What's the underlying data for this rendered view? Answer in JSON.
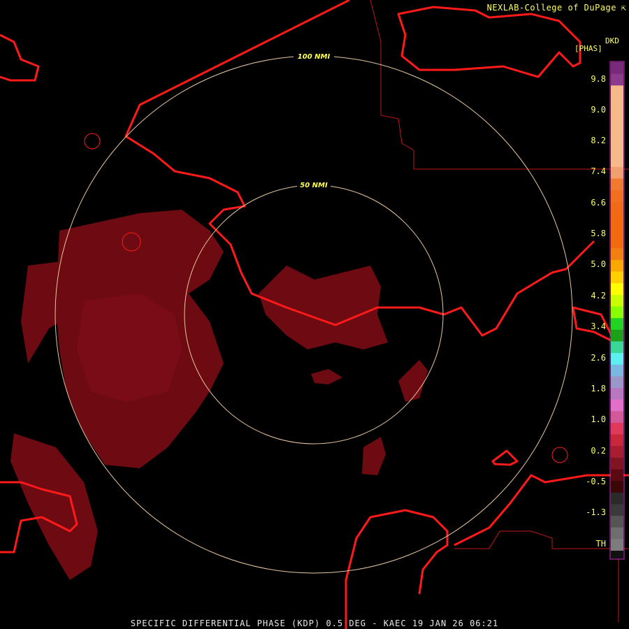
{
  "header": {
    "credit": "NEXLAB-College of DuPage",
    "credit_icon": "cursor-arrow-icon"
  },
  "legend": {
    "product_code": "DKD",
    "units": "[PHAS]",
    "ticks": [
      "9.8",
      "9.0",
      "8.2",
      "7.4",
      "6.6",
      "5.8",
      "5.0",
      "4.2",
      "3.4",
      "2.6",
      "1.8",
      "1.0",
      "0.2",
      "-0.5",
      "-1.3",
      "TH"
    ],
    "colors": [
      "#7a2a7a",
      "#8c3a8c",
      "#f6b98a",
      "#f6b98a",
      "#f6b98a",
      "#f6b98a",
      "#f6b98a",
      "#f6b98a",
      "#f6b98a",
      "#f0a070",
      "#f07a30",
      "#f07020",
      "#f06a18",
      "#f26a10",
      "#f26a10",
      "#f26a10",
      "#f28010",
      "#f8a800",
      "#ffd000",
      "#ffff00",
      "#c8ff00",
      "#88ff00",
      "#22d422",
      "#1ca01c",
      "#3ad898",
      "#5ef0f0",
      "#7ab8e0",
      "#9a98c8",
      "#b878c0",
      "#e070c8",
      "#d05a98",
      "#e03a5a",
      "#c8283a",
      "#a81e30",
      "#801420",
      "#5a0a10",
      "#3a0606",
      "#2a2a2a",
      "#3a3a3a",
      "#555555",
      "#6e6e6e",
      "#7c7c7c"
    ]
  },
  "map": {
    "range_rings": [
      {
        "label": "50 NMI"
      },
      {
        "label": "100 NMI"
      }
    ],
    "coast_color": "#ff1a1a",
    "echo_color": "#6e0a12",
    "echo_dense_color": "#7a0c18",
    "ring_color": "#e8c8a0"
  },
  "footer": {
    "caption": "SPECIFIC DIFFERENTIAL PHASE (KDP) 0.5 DEG - KAEC 19 JAN 26 06:21"
  }
}
